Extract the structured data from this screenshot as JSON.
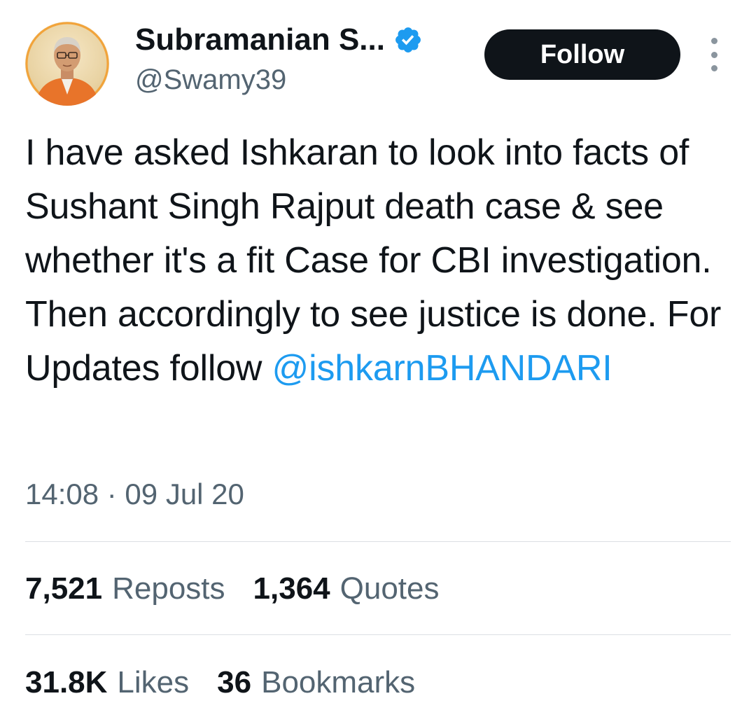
{
  "author": {
    "display_name": "Subramanian S...",
    "handle": "@Swamy39",
    "verified": true
  },
  "actions": {
    "follow_label": "Follow",
    "more_icon": "more-vertical-icon"
  },
  "tweet": {
    "text_before_mention": "I have asked Ishkaran to look into facts of Sushant Singh Rajput death case & see whether it's a fit Case for CBI investigation. Then accordingly to see justice is done. For Updates follow ",
    "mention": "@ishkarnBHANDARI",
    "timestamp": "14:08 · 09 Jul 20"
  },
  "stats": {
    "reposts_count": "7,521",
    "reposts_label": "Reposts",
    "quotes_count": "1,364",
    "quotes_label": "Quotes",
    "likes_count": "31.8K",
    "likes_label": "Likes",
    "bookmarks_count": "36",
    "bookmarks_label": "Bookmarks"
  },
  "colors": {
    "link": "#1d9bf0",
    "verified": "#1d9bf0",
    "secondary_text": "#536471",
    "primary_text": "#0f1419",
    "follow_button_bg": "#0f1419"
  }
}
